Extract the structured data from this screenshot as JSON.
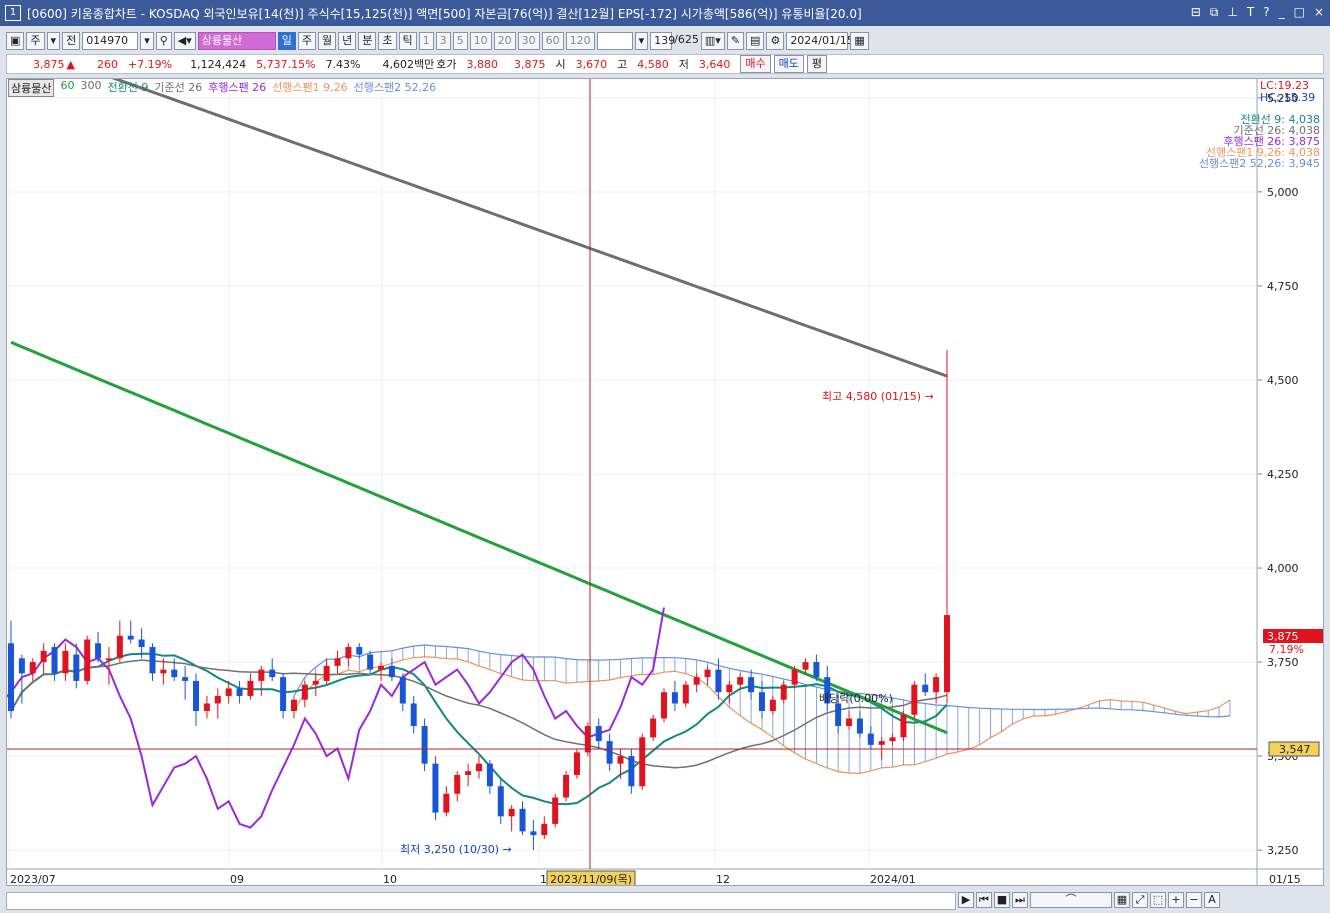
{
  "title": {
    "num": "1",
    "text": "[0600] 키움종합차트 - KOSDAQ 외국인보유[14(천)] 주식수[15,125(천)] 액면[500] 자본금[76(억)] 결산[12월] EPS[-172] 시가총액[586(억)] 유통비율[20.0]",
    "controls": [
      "⊟",
      "⧉",
      "⊥",
      "T",
      "?",
      "_",
      "□",
      "×"
    ]
  },
  "toolbar": {
    "period": "주",
    "code_label": "전",
    "code": "014970",
    "name": "삼륭물산",
    "tabs": [
      "일",
      "주",
      "월",
      "년",
      "분",
      "초",
      "틱"
    ],
    "numbers": [
      "1",
      "3",
      "5",
      "10",
      "20",
      "30",
      "60",
      "120"
    ],
    "count": "139",
    "total": "625",
    "date": "2024/01/15"
  },
  "quote": {
    "price": "3,875",
    "arrow": "▲",
    "change": "260",
    "rate": "+7.19%",
    "volume": "1,124,424",
    "vol_rate": "5,737.15%",
    "turnover": "7.43%",
    "amount": "4,602백만",
    "bid_label": "호가",
    "bid1": "3,880",
    "bid2": "3,875",
    "open_label": "시",
    "open": "3,670",
    "high_label": "고",
    "high": "4,580",
    "low_label": "저",
    "low": "3,640",
    "buy": "매수",
    "sell": "매도",
    "eval": "평"
  },
  "legend": {
    "name": "삼륭물산",
    "ma60": "60",
    "ma300": "300",
    "l1": "전환선 9",
    "l2": "기준선 26",
    "l3": "후행스팬 26",
    "l4": "선행스팬1 9,26",
    "l5": "선행스팬2 52,26"
  },
  "right_info": [
    "전환선 9: 4,038",
    "기준선 26: 4,038",
    "후행스팬 26: 3,875",
    "선행스팬1 9,26: 4,038",
    "선행스팬2 52,26: 3,945"
  ],
  "lc": "LC:19.23",
  "hc": "HC:-15.39",
  "yaxis": [
    "5,250",
    "5,000",
    "4,750",
    "4,500",
    "4,250",
    "4,000",
    "3,750",
    "3,500",
    "3,250"
  ],
  "xaxis": [
    "2023/07",
    "09",
    "10",
    "1",
    "12",
    "2024/01"
  ],
  "xaxis_right": "01/15",
  "cursor_date": "2023/11/09(목)",
  "price_tag": "3,875",
  "price_tag_rate": "7.19%",
  "line_tag": "3,547",
  "annot_high": "최고 4,580 (01/15) →",
  "annot_low": "최저 3,250 (10/30) →",
  "annot_div": "배당락(0.00%)",
  "colors": {
    "up": "#e0141e",
    "down": "#1a55d6",
    "ma60": "#22a03a",
    "ma300": "#6e6e6e",
    "tenkan": "#128a78",
    "kijun": "#707070",
    "chikou": "#9a2ad6",
    "spanA": "#f0945a",
    "spanB": "#6a8ee0"
  },
  "chart_data": {
    "type": "candlestick",
    "ylim": [
      3200,
      5300
    ],
    "candles": [
      [
        3800,
        3860,
        3600,
        3620
      ],
      [
        3760,
        3770,
        3640,
        3720
      ],
      [
        3720,
        3760,
        3700,
        3750
      ],
      [
        3750,
        3800,
        3720,
        3780
      ],
      [
        3790,
        3800,
        3700,
        3720
      ],
      [
        3720,
        3800,
        3700,
        3780
      ],
      [
        3770,
        3800,
        3680,
        3700
      ],
      [
        3700,
        3820,
        3690,
        3810
      ],
      [
        3800,
        3830,
        3750,
        3760
      ],
      [
        3760,
        3790,
        3690,
        3760
      ],
      [
        3760,
        3860,
        3750,
        3820
      ],
      [
        3820,
        3860,
        3800,
        3810
      ],
      [
        3810,
        3840,
        3760,
        3790
      ],
      [
        3790,
        3800,
        3700,
        3720
      ],
      [
        3720,
        3760,
        3690,
        3730
      ],
      [
        3730,
        3760,
        3700,
        3710
      ],
      [
        3710,
        3740,
        3650,
        3700
      ],
      [
        3700,
        3720,
        3580,
        3620
      ],
      [
        3620,
        3660,
        3600,
        3640
      ],
      [
        3640,
        3680,
        3600,
        3660
      ],
      [
        3660,
        3700,
        3640,
        3680
      ],
      [
        3680,
        3700,
        3640,
        3660
      ],
      [
        3660,
        3720,
        3650,
        3700
      ],
      [
        3700,
        3740,
        3660,
        3730
      ],
      [
        3730,
        3760,
        3700,
        3710
      ],
      [
        3710,
        3720,
        3600,
        3620
      ],
      [
        3620,
        3660,
        3600,
        3650
      ],
      [
        3650,
        3700,
        3630,
        3690
      ],
      [
        3690,
        3720,
        3660,
        3700
      ],
      [
        3700,
        3760,
        3690,
        3740
      ],
      [
        3740,
        3780,
        3720,
        3760
      ],
      [
        3760,
        3800,
        3740,
        3790
      ],
      [
        3790,
        3800,
        3760,
        3770
      ],
      [
        3770,
        3780,
        3720,
        3730
      ],
      [
        3730,
        3750,
        3700,
        3740
      ],
      [
        3740,
        3760,
        3700,
        3710
      ],
      [
        3710,
        3720,
        3620,
        3640
      ],
      [
        3640,
        3660,
        3560,
        3580
      ],
      [
        3580,
        3600,
        3460,
        3480
      ],
      [
        3480,
        3500,
        3330,
        3350
      ],
      [
        3350,
        3420,
        3340,
        3400
      ],
      [
        3400,
        3460,
        3380,
        3450
      ],
      [
        3450,
        3480,
        3420,
        3460
      ],
      [
        3460,
        3500,
        3440,
        3480
      ],
      [
        3480,
        3490,
        3400,
        3420
      ],
      [
        3420,
        3440,
        3320,
        3340
      ],
      [
        3340,
        3370,
        3300,
        3360
      ],
      [
        3360,
        3380,
        3290,
        3300
      ],
      [
        3300,
        3330,
        3250,
        3290
      ],
      [
        3290,
        3340,
        3280,
        3320
      ],
      [
        3320,
        3400,
        3310,
        3390
      ],
      [
        3390,
        3460,
        3380,
        3450
      ],
      [
        3450,
        3520,
        3440,
        3510
      ],
      [
        3510,
        3590,
        3500,
        3580
      ],
      [
        3580,
        3600,
        3520,
        3540
      ],
      [
        3540,
        3560,
        3460,
        3480
      ],
      [
        3480,
        3520,
        3440,
        3500
      ],
      [
        3500,
        3520,
        3400,
        3420
      ],
      [
        3420,
        3560,
        3410,
        3550
      ],
      [
        3550,
        3610,
        3540,
        3600
      ],
      [
        3600,
        3680,
        3590,
        3670
      ],
      [
        3670,
        3700,
        3620,
        3640
      ],
      [
        3640,
        3700,
        3630,
        3690
      ],
      [
        3690,
        3720,
        3670,
        3710
      ],
      [
        3710,
        3740,
        3690,
        3730
      ],
      [
        3730,
        3760,
        3650,
        3670
      ],
      [
        3670,
        3700,
        3640,
        3690
      ],
      [
        3690,
        3720,
        3680,
        3710
      ],
      [
        3710,
        3730,
        3650,
        3670
      ],
      [
        3670,
        3700,
        3600,
        3620
      ],
      [
        3620,
        3660,
        3610,
        3650
      ],
      [
        3650,
        3700,
        3640,
        3690
      ],
      [
        3690,
        3740,
        3680,
        3730
      ],
      [
        3730,
        3760,
        3720,
        3750
      ],
      [
        3750,
        3770,
        3700,
        3710
      ],
      [
        3710,
        3740,
        3620,
        3640
      ],
      [
        3640,
        3660,
        3560,
        3580
      ],
      [
        3580,
        3620,
        3570,
        3600
      ],
      [
        3600,
        3620,
        3550,
        3560
      ],
      [
        3560,
        3580,
        3520,
        3530
      ],
      [
        3530,
        3550,
        3490,
        3540
      ],
      [
        3540,
        3560,
        3530,
        3550
      ],
      [
        3550,
        3620,
        3540,
        3610
      ],
      [
        3610,
        3700,
        3600,
        3690
      ],
      [
        3690,
        3720,
        3660,
        3670
      ],
      [
        3670,
        3720,
        3640,
        3710
      ],
      [
        3670,
        4580,
        3640,
        3875
      ]
    ]
  }
}
